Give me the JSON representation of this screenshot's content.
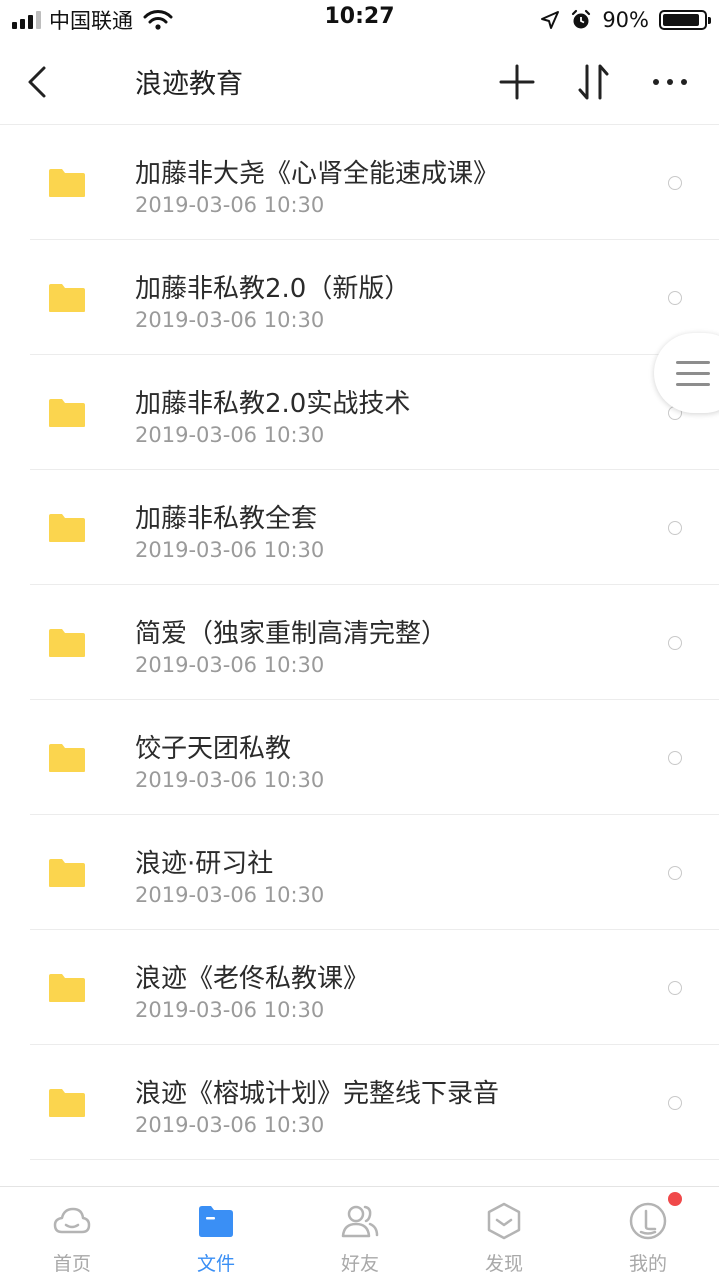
{
  "status_bar": {
    "carrier": "中国联通",
    "time": "10:27",
    "battery": "90%",
    "battery_level": 0.9
  },
  "nav": {
    "title": "浪迹教育"
  },
  "files": [
    {
      "name": "加藤非大尧《心肾全能速成课》",
      "date": "2019-03-06 10:30"
    },
    {
      "name": "加藤非私教2.0（新版）",
      "date": "2019-03-06 10:30"
    },
    {
      "name": "加藤非私教2.0实战技术",
      "date": "2019-03-06 10:30"
    },
    {
      "name": "加藤非私教全套",
      "date": "2019-03-06 10:30"
    },
    {
      "name": "简爱（独家重制高清完整）",
      "date": "2019-03-06 10:30"
    },
    {
      "name": "饺子天团私教",
      "date": "2019-03-06 10:30"
    },
    {
      "name": "浪迹·研习社",
      "date": "2019-03-06 10:30"
    },
    {
      "name": "浪迹《老佟私教课》",
      "date": "2019-03-06 10:30"
    },
    {
      "name": "浪迹《榕城计划》完整线下录音",
      "date": "2019-03-06 10:30"
    }
  ],
  "tabs": [
    {
      "label": "首页",
      "icon": "cloud-icon"
    },
    {
      "label": "文件",
      "icon": "folder-icon"
    },
    {
      "label": "好友",
      "icon": "friends-icon"
    },
    {
      "label": "发现",
      "icon": "discover-icon"
    },
    {
      "label": "我的",
      "icon": "profile-icon"
    }
  ],
  "colors": {
    "accent": "#3a8ff5",
    "folder": "#fbd54e",
    "badge": "#f0494a"
  }
}
